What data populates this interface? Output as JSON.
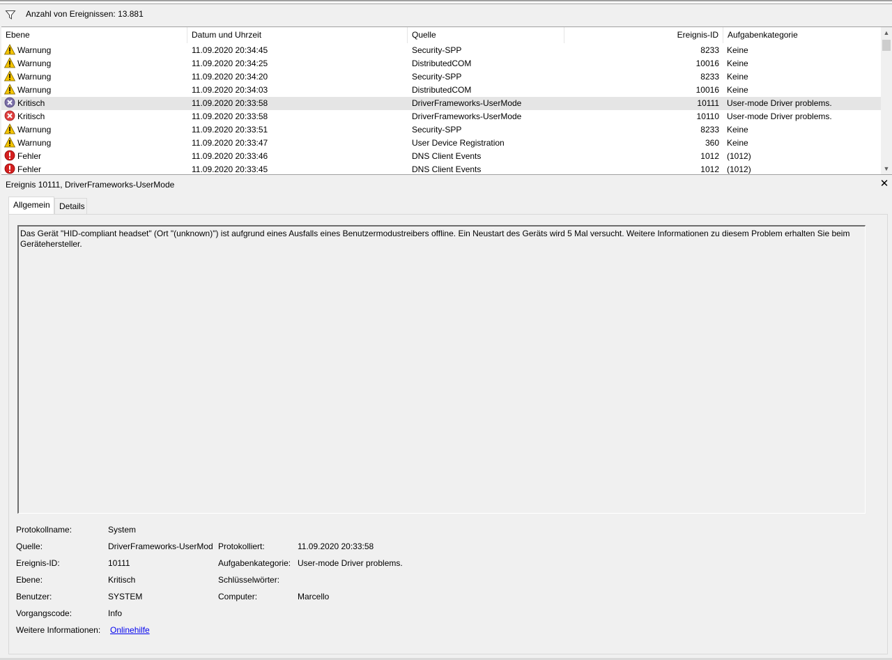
{
  "filter": {
    "icon": "funnel-icon",
    "count_text": "Anzahl von Ereignissen: 13.881"
  },
  "list": {
    "columns": [
      "Ebene",
      "Datum und Uhrzeit",
      "Quelle",
      "Ereignis-ID",
      "Aufgabenkategorie"
    ],
    "rows": [
      {
        "level": "Warnung",
        "icon": "warning-icon",
        "date": "11.09.2020 20:34:45",
        "source": "Security-SPP",
        "id": "8233",
        "category": "Keine"
      },
      {
        "level": "Warnung",
        "icon": "warning-icon",
        "date": "11.09.2020 20:34:25",
        "source": "DistributedCOM",
        "id": "10016",
        "category": "Keine"
      },
      {
        "level": "Warnung",
        "icon": "warning-icon",
        "date": "11.09.2020 20:34:20",
        "source": "Security-SPP",
        "id": "8233",
        "category": "Keine"
      },
      {
        "level": "Warnung",
        "icon": "warning-icon",
        "date": "11.09.2020 20:34:03",
        "source": "DistributedCOM",
        "id": "10016",
        "category": "Keine"
      },
      {
        "level": "Kritisch",
        "icon": "critical-icon",
        "date": "11.09.2020 20:33:58",
        "source": "DriverFrameworks-UserMode",
        "id": "10111",
        "category": "User-mode Driver problems.",
        "selected": true
      },
      {
        "level": "Kritisch",
        "icon": "critical-icon",
        "date": "11.09.2020 20:33:58",
        "source": "DriverFrameworks-UserMode",
        "id": "10110",
        "category": "User-mode Driver problems."
      },
      {
        "level": "Warnung",
        "icon": "warning-icon",
        "date": "11.09.2020 20:33:51",
        "source": "Security-SPP",
        "id": "8233",
        "category": "Keine"
      },
      {
        "level": "Warnung",
        "icon": "warning-icon",
        "date": "11.09.2020 20:33:47",
        "source": "User Device Registration",
        "id": "360",
        "category": "Keine"
      },
      {
        "level": "Fehler",
        "icon": "error-icon",
        "date": "11.09.2020 20:33:46",
        "source": "DNS Client Events",
        "id": "1012",
        "category": "(1012)"
      },
      {
        "level": "Fehler",
        "icon": "error-icon",
        "date": "11.09.2020 20:33:45",
        "source": "DNS Client Events",
        "id": "1012",
        "category": "(1012)"
      }
    ]
  },
  "detail": {
    "title": "Ereignis 10111, DriverFrameworks-UserMode",
    "close_label": "✕",
    "tabs": [
      "Allgemein",
      "Details"
    ],
    "description": "Das Gerät \"HID-compliant headset\" (Ort \"(unknown)\") ist aufgrund eines Ausfalls eines Benutzermodustreibers offline. Ein Neustart des Geräts wird 5 Mal versucht. Weitere Informationen zu diesem Problem erhalten Sie beim Gerätehersteller.",
    "props": {
      "log_name_label": "Protokollname:",
      "log_name": "System",
      "source_label": "Quelle:",
      "source": "DriverFrameworks-UserMod",
      "logged_label": "Protokolliert:",
      "logged": "11.09.2020 20:33:58",
      "event_id_label": "Ereignis-ID:",
      "event_id": "10111",
      "task_cat_label": "Aufgabenkategorie:",
      "task_cat": "User-mode Driver problems.",
      "level_label": "Ebene:",
      "level": "Kritisch",
      "keywords_label": "Schlüsselwörter:",
      "keywords": "",
      "user_label": "Benutzer:",
      "user": "SYSTEM",
      "computer_label": "Computer:",
      "computer": "Marcello",
      "opcode_label": "Vorgangscode:",
      "opcode": "Info",
      "more_info_label": "Weitere Informationen:",
      "more_info_link": "Onlinehilfe"
    }
  }
}
